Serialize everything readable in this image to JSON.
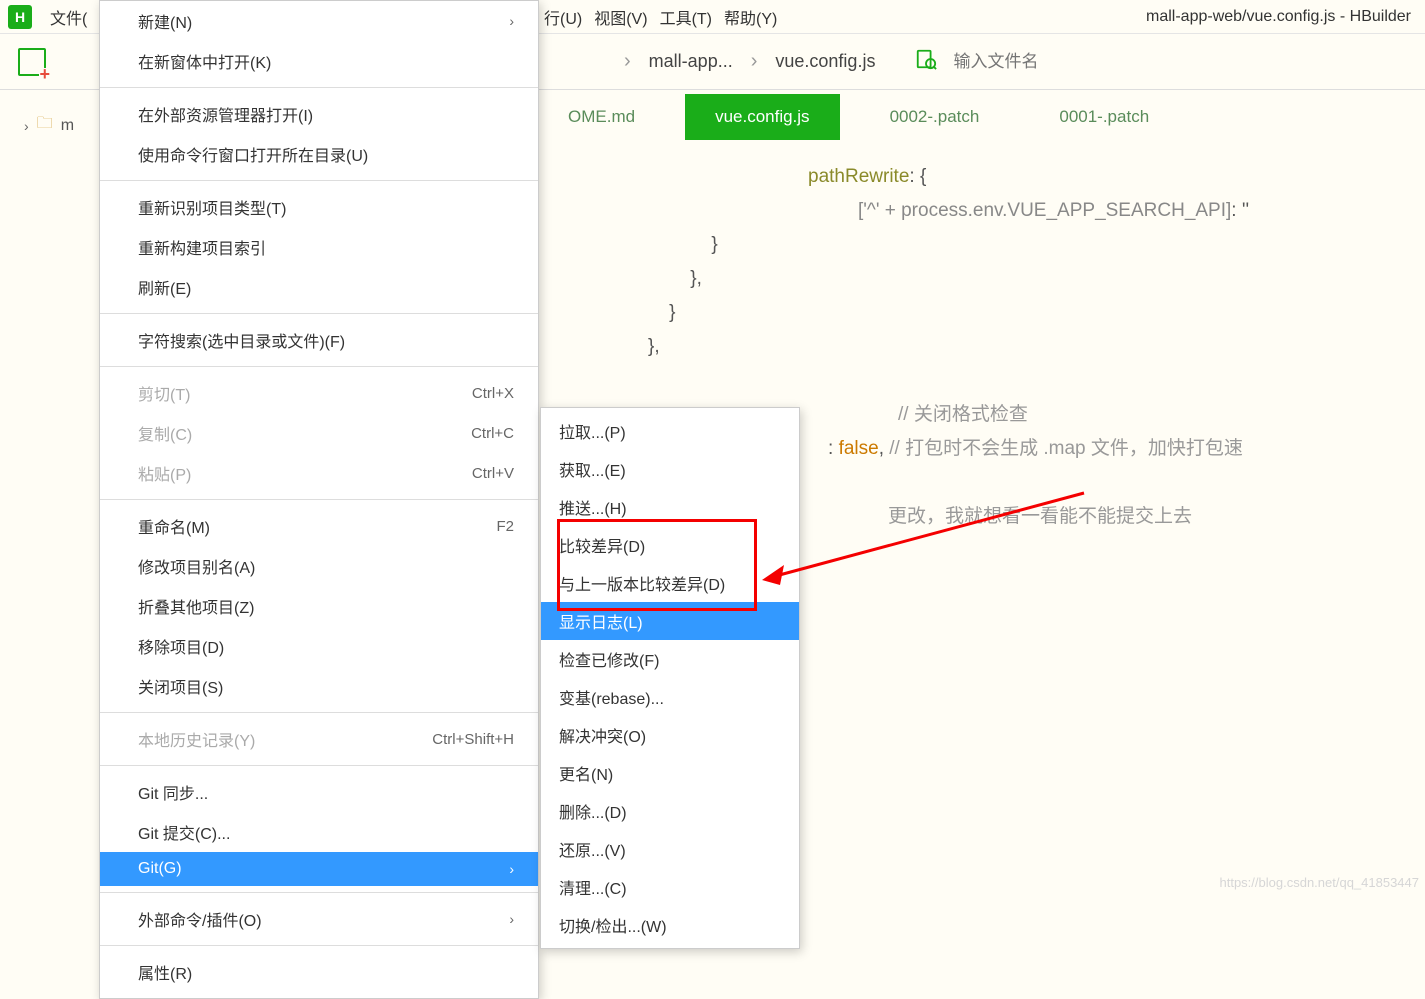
{
  "app_icon_letter": "H",
  "menubar": {
    "file": "文件(",
    "run": "行(U)",
    "view": "视图(V)",
    "tools": "工具(T)",
    "help": "帮助(Y)"
  },
  "title": "mall-app-web/vue.config.js - HBuilder",
  "breadcrumb": {
    "p1": "mall-app...",
    "p2": "vue.config.js"
  },
  "search_placeholder": "输入文件名",
  "sidebar": {
    "item0": "m"
  },
  "tabs": {
    "t0": "OME.md",
    "t1": "vue.config.js",
    "t2": "0002-.patch",
    "t3": "0001-.patch"
  },
  "code": {
    "l1_prop": "pathRewrite",
    "l1_rest": ": {",
    "l2a": "['^' + process.env.VUE_APP_SEARCH_API]",
    "l2b": ": ''",
    "l3": "            }",
    "l4": "        },",
    "l5": "    }",
    "l6": "},",
    "l7_comment": "// 关闭格式检查",
    "l8_a": ": ",
    "l8_b": "false",
    "l8_c": ", ",
    "l8_comment": "// 打包时不会生成 .map 文件，加快打包速",
    "l9": "更改，我就想看一看能不能提交上去"
  },
  "ctx": {
    "new": "新建(N)",
    "open_new_window": "在新窗体中打开(K)",
    "open_external": "在外部资源管理器打开(I)",
    "open_cmd": "使用命令行窗口打开所在目录(U)",
    "reidentify": "重新识别项目类型(T)",
    "rebuild_index": "重新构建项目索引",
    "refresh": "刷新(E)",
    "search": "字符搜索(选中目录或文件)(F)",
    "cut": "剪切(T)",
    "cut_sc": "Ctrl+X",
    "copy": "复制(C)",
    "copy_sc": "Ctrl+C",
    "paste": "粘贴(P)",
    "paste_sc": "Ctrl+V",
    "rename": "重命名(M)",
    "rename_sc": "F2",
    "alias": "修改项目别名(A)",
    "fold": "折叠其他项目(Z)",
    "remove": "移除项目(D)",
    "close": "关闭项目(S)",
    "history": "本地历史记录(Y)",
    "history_sc": "Ctrl+Shift+H",
    "git_sync": "Git 同步...",
    "git_commit": "Git 提交(C)...",
    "git": "Git(G)",
    "ext_cmd": "外部命令/插件(O)",
    "props": "属性(R)"
  },
  "sub": {
    "pull": "拉取...(P)",
    "fetch": "获取...(E)",
    "push": "推送...(H)",
    "diff": "比较差异(D)",
    "diff_prev": "与上一版本比较差异(D)",
    "show_log": "显示日志(L)",
    "check_mod": "检查已修改(F)",
    "rebase": "变基(rebase)...",
    "resolve": "解决冲突(O)",
    "rename2": "更名(N)",
    "delete": "删除...(D)",
    "revert": "还原...(V)",
    "clean": "清理...(C)",
    "switch": "切换/检出...(W)"
  },
  "watermark": "https://blog.csdn.net/qq_41853447"
}
